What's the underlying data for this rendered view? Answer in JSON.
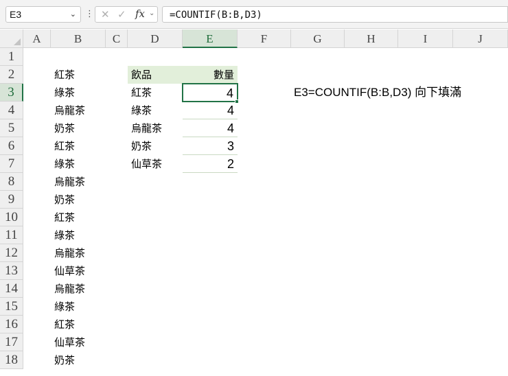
{
  "name_box": "E3",
  "formula_bar": "=COUNTIF(B:B,D3)",
  "columns": [
    "A",
    "B",
    "C",
    "D",
    "E",
    "F",
    "G",
    "H",
    "I",
    "J"
  ],
  "rows": [
    "1",
    "2",
    "3",
    "4",
    "5",
    "6",
    "7",
    "8",
    "9",
    "10",
    "11",
    "12",
    "13",
    "14",
    "15",
    "16",
    "17",
    "18"
  ],
  "column_b": [
    "紅茶",
    "綠茶",
    "烏龍茶",
    "奶茶",
    "紅茶",
    "綠茶",
    "烏龍茶",
    "奶茶",
    "紅茶",
    "綠茶",
    "烏龍茶",
    "仙草茶",
    "烏龍茶",
    "綠茶",
    "紅茶",
    "仙草茶",
    "奶茶"
  ],
  "summary_table": {
    "header_drink": "飲品",
    "header_count": "數量",
    "rows": [
      {
        "drink": "紅茶",
        "count": "4"
      },
      {
        "drink": "綠茶",
        "count": "4"
      },
      {
        "drink": "烏龍茶",
        "count": "4"
      },
      {
        "drink": "奶茶",
        "count": "3"
      },
      {
        "drink": "仙草茶",
        "count": "2"
      }
    ]
  },
  "note": "E3=COUNTIF(B:B,D3) 向下填滿",
  "selected_cell": "E3",
  "accent_color": "#217346",
  "header_fill_color": "#e2efda",
  "icons": [
    "cancel-icon",
    "enter-icon",
    "function-icon",
    "dropdown-caret-icon"
  ]
}
